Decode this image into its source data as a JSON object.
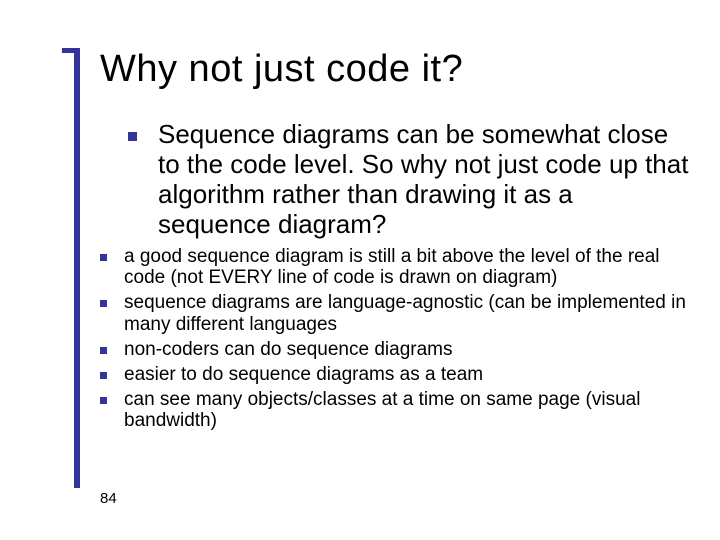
{
  "slide": {
    "title": "Why not just code it?",
    "main_point": "Sequence diagrams can be somewhat close to the code level. So why not just code up that algorithm rather than drawing it as a sequence diagram?",
    "sub_points": [
      "a good sequence diagram is still a bit above the level of the real code (not EVERY line of code is drawn on diagram)",
      "sequence diagrams are language-agnostic (can be implemented in many different languages",
      "non-coders can do sequence diagrams",
      "easier to do sequence diagrams as a team",
      "can see many objects/classes at a time on same page (visual bandwidth)"
    ],
    "page_number": "84"
  }
}
